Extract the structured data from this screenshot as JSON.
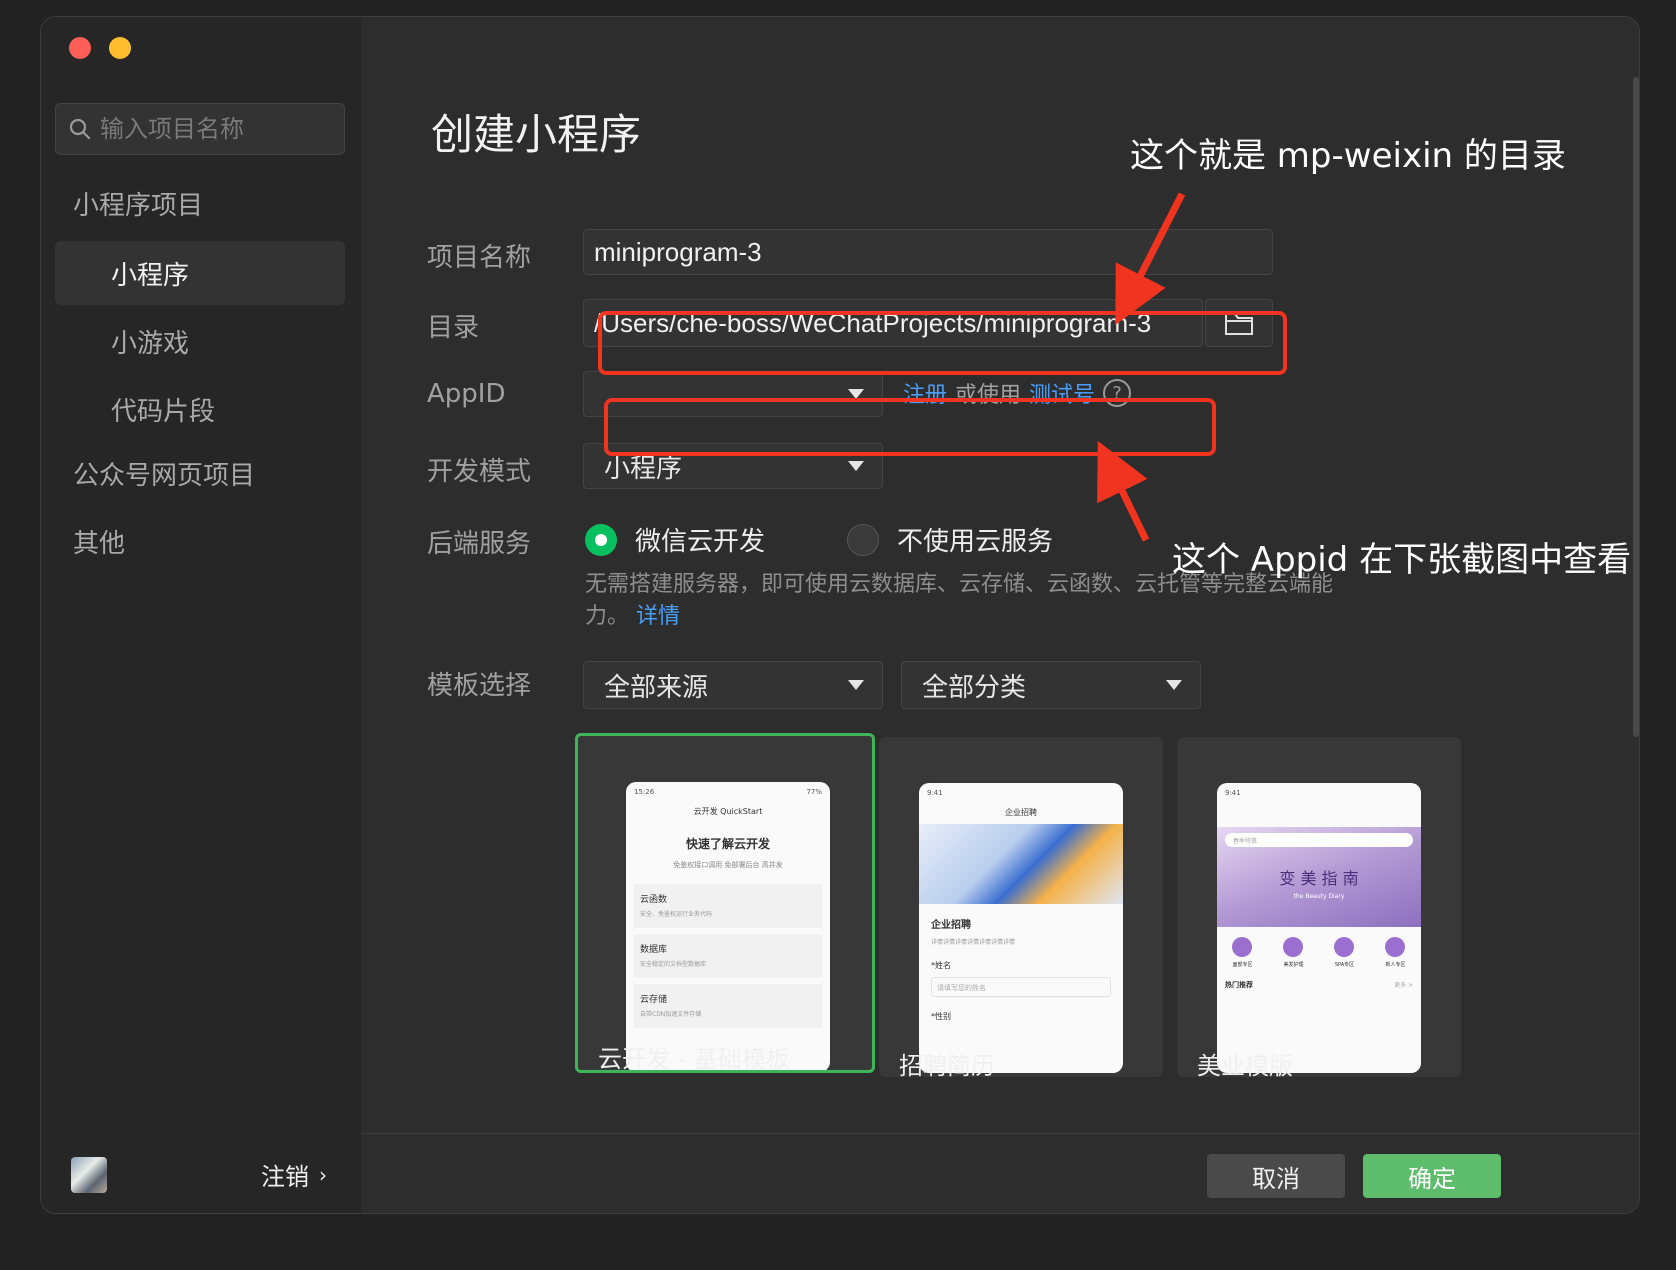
{
  "sidebar": {
    "search_placeholder": "输入项目名称",
    "group_miniprogram": "小程序项目",
    "items": [
      {
        "label": "小程序"
      },
      {
        "label": "小游戏"
      },
      {
        "label": "代码片段"
      }
    ],
    "group_official": "公众号网页项目",
    "group_other": "其他",
    "logout_label": "注销"
  },
  "main": {
    "title": "创建小程序",
    "project_name_label": "项目名称",
    "project_name_value": "miniprogram-3",
    "directory_label": "目录",
    "directory_value": "/Users/che-boss/WeChatProjects/miniprogram-3",
    "appid_label": "AppID",
    "appid_value": "",
    "appid_register": "注册",
    "appid_or_use": "或使用",
    "appid_test": "测试号",
    "dev_mode_label": "开发模式",
    "dev_mode_value": "小程序",
    "backend_label": "后端服务",
    "backend_option_cloud": "微信云开发",
    "backend_option_none": "不使用云服务",
    "backend_desc_line1": "无需搭建服务器，即可使用云数据库、云存储、云函数、云托管等完整云端能",
    "backend_desc_line2": "力。",
    "backend_desc_link": "详情",
    "template_label": "模板选择",
    "template_source": "全部来源",
    "template_category": "全部分类",
    "templates": [
      {
        "name": "云开发 - 基础模板"
      },
      {
        "name": "招聘简历"
      },
      {
        "name": "美业模版"
      }
    ]
  },
  "phone_previews": {
    "cloud": {
      "time": "15:26",
      "battery": "77%",
      "title": "云开发 QuickStart",
      "heading": "快速了解云开发",
      "sub": "免鉴权接口调用 免部署后台 高并发",
      "rows": [
        {
          "name": "云函数",
          "desc": "安全、免鉴权运行业务代码"
        },
        {
          "name": "数据库",
          "desc": "安全稳定的文档型数据库"
        },
        {
          "name": "云存储",
          "desc": "自带CDN加速文件存储"
        }
      ]
    },
    "recruit": {
      "time": "9:41",
      "title": "企业招聘",
      "heading": "企业招聘",
      "sub": "详情详情详情详情详情详情详情",
      "field_label": "*姓名",
      "field_placeholder": "请填写您的姓名",
      "field2_label": "*性别"
    },
    "beauty": {
      "time": "9:41",
      "search": "春季特惠",
      "heading": "变 美 指 南",
      "sub": "the Beauty Diary",
      "icons": [
        "面部专区",
        "美发护理",
        "SPA专区",
        "新人专区"
      ],
      "section": "热门推荐",
      "more": "更多 >"
    }
  },
  "footer": {
    "cancel": "取消",
    "confirm": "确定"
  },
  "annotations": {
    "top": "这个就是 mp-weixin 的目录",
    "bottom": "这个 Appid 在下张截图中查看"
  },
  "colors": {
    "accent_green": "#07c160",
    "link_blue": "#4a9df8",
    "annotation_red": "#f0341f"
  }
}
